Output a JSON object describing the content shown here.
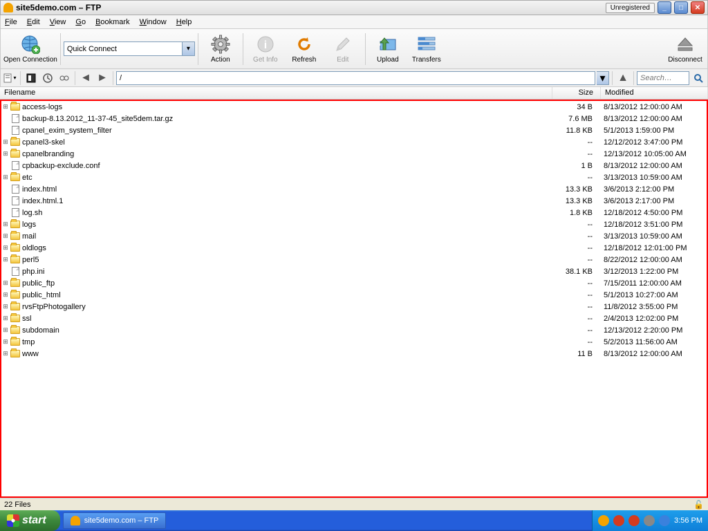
{
  "title": "site5demo.com – FTP",
  "unregistered": "Unregistered",
  "menu": [
    "File",
    "Edit",
    "View",
    "Go",
    "Bookmark",
    "Window",
    "Help"
  ],
  "toolbar": {
    "open_connection": "Open Connection",
    "quick_connect": "Quick Connect",
    "action": "Action",
    "get_info": "Get Info",
    "refresh": "Refresh",
    "edit": "Edit",
    "upload": "Upload",
    "transfers": "Transfers",
    "disconnect": "Disconnect"
  },
  "navbar": {
    "path": "/",
    "search_placeholder": "Search…"
  },
  "columns": {
    "name": "Filename",
    "size": "Size",
    "modified": "Modified"
  },
  "files": [
    {
      "exp": "+",
      "type": "folder",
      "name": "access-logs",
      "size": "34 B",
      "mod": "8/13/2012 12:00:00 AM"
    },
    {
      "exp": "",
      "type": "file",
      "name": "backup-8.13.2012_11-37-45_site5dem.tar.gz",
      "size": "7.6 MB",
      "mod": "8/13/2012 12:00:00 AM"
    },
    {
      "exp": "",
      "type": "file",
      "name": "cpanel_exim_system_filter",
      "size": "11.8 KB",
      "mod": "5/1/2013 1:59:00 PM"
    },
    {
      "exp": "+",
      "type": "folder",
      "name": "cpanel3-skel",
      "size": "--",
      "mod": "12/12/2012 3:47:00 PM"
    },
    {
      "exp": "+",
      "type": "folder",
      "name": "cpanelbranding",
      "size": "--",
      "mod": "12/13/2012 10:05:00 AM"
    },
    {
      "exp": "",
      "type": "file",
      "name": "cpbackup-exclude.conf",
      "size": "1 B",
      "mod": "8/13/2012 12:00:00 AM"
    },
    {
      "exp": "+",
      "type": "folder",
      "name": "etc",
      "size": "--",
      "mod": "3/13/2013 10:59:00 AM"
    },
    {
      "exp": "",
      "type": "file",
      "name": "index.html",
      "size": "13.3 KB",
      "mod": "3/6/2013 2:12:00 PM"
    },
    {
      "exp": "",
      "type": "file",
      "name": "index.html.1",
      "size": "13.3 KB",
      "mod": "3/6/2013 2:17:00 PM"
    },
    {
      "exp": "",
      "type": "file",
      "name": "log.sh",
      "size": "1.8 KB",
      "mod": "12/18/2012 4:50:00 PM"
    },
    {
      "exp": "+",
      "type": "folder",
      "name": "logs",
      "size": "--",
      "mod": "12/18/2012 3:51:00 PM"
    },
    {
      "exp": "+",
      "type": "folder",
      "name": "mail",
      "size": "--",
      "mod": "3/13/2013 10:59:00 AM"
    },
    {
      "exp": "+",
      "type": "folder",
      "name": "oldlogs",
      "size": "--",
      "mod": "12/18/2012 12:01:00 PM"
    },
    {
      "exp": "+",
      "type": "folder",
      "name": "perl5",
      "size": "--",
      "mod": "8/22/2012 12:00:00 AM"
    },
    {
      "exp": "",
      "type": "file",
      "name": "php.ini",
      "size": "38.1 KB",
      "mod": "3/12/2013 1:22:00 PM"
    },
    {
      "exp": "+",
      "type": "folder",
      "name": "public_ftp",
      "size": "--",
      "mod": "7/15/2011 12:00:00 AM"
    },
    {
      "exp": "+",
      "type": "folder",
      "name": "public_html",
      "size": "--",
      "mod": "5/1/2013 10:27:00 AM"
    },
    {
      "exp": "+",
      "type": "folder",
      "name": "rvsFtpPhotogallery",
      "size": "--",
      "mod": "11/8/2012 3:55:00 PM"
    },
    {
      "exp": "+",
      "type": "folder",
      "name": "ssl",
      "size": "--",
      "mod": "2/4/2013 12:02:00 PM"
    },
    {
      "exp": "+",
      "type": "folder",
      "name": "subdomain",
      "size": "--",
      "mod": "12/13/2012 2:20:00 PM"
    },
    {
      "exp": "+",
      "type": "folder",
      "name": "tmp",
      "size": "--",
      "mod": "5/2/2013 11:56:00 AM"
    },
    {
      "exp": "+",
      "type": "folder",
      "name": "www",
      "size": "11 B",
      "mod": "8/13/2012 12:00:00 AM"
    }
  ],
  "status": {
    "count": "22 Files"
  },
  "taskbar": {
    "start": "start",
    "task": "site5demo.com – FTP",
    "time": "3:56 PM"
  }
}
